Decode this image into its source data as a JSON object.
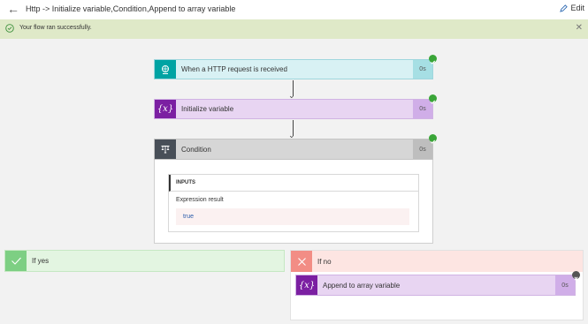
{
  "header": {
    "back_icon": "back-arrow-icon",
    "title": "Http -> Initialize variable,Condition,Append to array variable",
    "edit_label": "Edit",
    "edit_icon": "pencil-icon"
  },
  "banner": {
    "message": "Your flow ran successfully.",
    "status_icon": "check-circle-icon",
    "close_icon": "close-icon"
  },
  "steps": [
    {
      "label": "When a HTTP request is received",
      "duration": "0s",
      "status": "succeeded",
      "icon": "http-request-icon",
      "color": "#00a3a3",
      "body_color": "#d8f1f4",
      "dur_color": "#a6dfe4"
    },
    {
      "label": "Initialize variable",
      "duration": "0s",
      "status": "succeeded",
      "icon": "variable-icon",
      "icon_text": "{x}",
      "color": "#7b1fa2",
      "body_color": "#e8d5f2",
      "dur_color": "#d0aee8"
    },
    {
      "label": "Condition",
      "duration": "0s",
      "status": "succeeded",
      "icon": "condition-icon",
      "color": "#484f58",
      "body_color": "#d6d6d6",
      "dur_color": "#bebebe"
    }
  ],
  "condition": {
    "inputs_header": "INPUTS",
    "expression_label": "Expression result",
    "expression_value": "true"
  },
  "branches": {
    "yes": {
      "label": "If yes",
      "icon": "check-icon",
      "color": "#7dcf83",
      "body_color": "#e3f5e1"
    },
    "no": {
      "label": "If no",
      "icon": "x-icon",
      "color": "#f28d85",
      "body_color": "#fde5e2"
    }
  },
  "no_step": {
    "label": "Append to array variable",
    "duration": "0s",
    "status": "skipped",
    "icon": "variable-icon",
    "icon_text": "{x}",
    "color": "#7b1fa2",
    "body_color": "#e8d5f2",
    "dur_color": "#d0aee8"
  }
}
